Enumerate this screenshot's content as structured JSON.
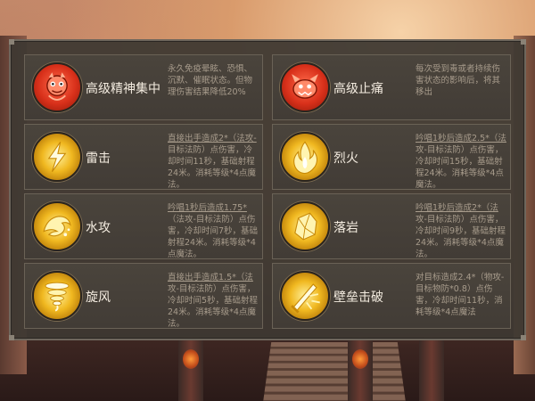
{
  "skills": [
    {
      "name": "高级精神集中",
      "description": "永久免疫晕眩、恐惧、沉默、催眠状态。但物理伤害结果降低20%",
      "icon": "red-demon-icon",
      "icon_color": "#d8301a"
    },
    {
      "name": "高级止痛",
      "description": "每次受到毒或者持续伤害状态的影响后，将其移出",
      "icon": "red-beast-icon",
      "icon_color": "#d8301a"
    },
    {
      "name": "雷击",
      "description": "直接出手造成2*（法攻-目标法防）点伤害，冷却时间11秒，基础射程24米。消耗等级*4点魔法。",
      "icon": "lightning-icon",
      "icon_color": "#f0b820"
    },
    {
      "name": "烈火",
      "description": "吟唱1秒后造成2.5*（法攻-目标法防）点伤害，冷却时间15秒，基础射程24米。消耗等级*4点魔法。",
      "icon": "fire-icon",
      "icon_color": "#f0b820"
    },
    {
      "name": "水攻",
      "description": "吟唱1秒后造成1.75*（法攻-目标法防）点伤害，冷却时间7秒，基础射程24米。消耗等级*4点魔法。",
      "icon": "water-wave-icon",
      "icon_color": "#f0b820"
    },
    {
      "name": "落岩",
      "description": "吟唱1秒后造成2*（法攻-目标法防）点伤害，冷却时间9秒，基础射程24米。消耗等级*4点魔法。",
      "icon": "rock-icon",
      "icon_color": "#f0b820"
    },
    {
      "name": "旋风",
      "description": "直接出手造成1.5*（法攻-目标法防）点伤害，冷却时间5秒，基础射程24米。消耗等级*4点魔法。",
      "icon": "whirlwind-icon",
      "icon_color": "#f0b820"
    },
    {
      "name": "壁垒击破",
      "description": "对目标造成2.4*（物攻-目标物防*0.8）点伤害，冷却时间11秒，消耗等级*4点魔法",
      "icon": "sword-break-icon",
      "icon_color": "#f0b820"
    }
  ]
}
